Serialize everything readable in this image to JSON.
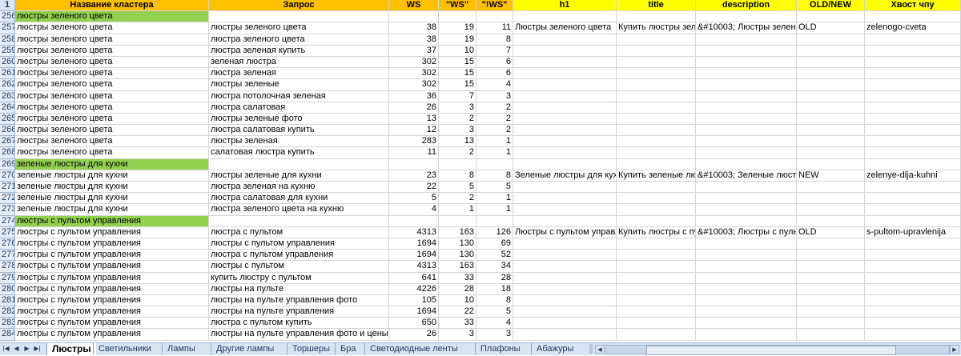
{
  "header": {
    "rownum": "1",
    "cols": [
      "Название кластера",
      "Запрос",
      "WS",
      "\"WS\"",
      "\"!WS\"",
      "h1",
      "title",
      "description",
      "OLD/NEW",
      "Хвост чпу"
    ]
  },
  "rows": [
    {
      "n": "256",
      "group": true,
      "name": "люстры зеленого цвета"
    },
    {
      "n": "257",
      "name": "люстры зеленого цвета",
      "q": "люстры зеленого цвета",
      "ws": "38",
      "ws2": "19",
      "ws3": "11",
      "h1": "Люстры зеленого цвета",
      "title": "Купить люстры зеле",
      "desc": "&#10003; Люстры зеленого",
      "old": "OLD",
      "tail": "zelenogo-cveta"
    },
    {
      "n": "258",
      "name": "люстры зеленого цвета",
      "q": "люстра зеленого цвета",
      "ws": "38",
      "ws2": "19",
      "ws3": "8"
    },
    {
      "n": "259",
      "name": "люстры зеленого цвета",
      "q": "люстра зеленая купить",
      "ws": "37",
      "ws2": "10",
      "ws3": "7"
    },
    {
      "n": "260",
      "name": "люстры зеленого цвета",
      "q": "зеленая люстра",
      "ws": "302",
      "ws2": "15",
      "ws3": "6"
    },
    {
      "n": "261",
      "name": "люстры зеленого цвета",
      "q": "люстра зеленая",
      "ws": "302",
      "ws2": "15",
      "ws3": "6"
    },
    {
      "n": "262",
      "name": "люстры зеленого цвета",
      "q": "люстры зеленые",
      "ws": "302",
      "ws2": "15",
      "ws3": "4"
    },
    {
      "n": "263",
      "name": "люстры зеленого цвета",
      "q": "люстра потолочная зеленая",
      "ws": "36",
      "ws2": "7",
      "ws3": "3"
    },
    {
      "n": "264",
      "name": "люстры зеленого цвета",
      "q": "люстра салатовая",
      "ws": "26",
      "ws2": "3",
      "ws3": "2"
    },
    {
      "n": "265",
      "name": "люстры зеленого цвета",
      "q": "люстры зеленые фото",
      "ws": "13",
      "ws2": "2",
      "ws3": "2"
    },
    {
      "n": "266",
      "name": "люстры зеленого цвета",
      "q": "люстра салатовая купить",
      "ws": "12",
      "ws2": "3",
      "ws3": "2"
    },
    {
      "n": "267",
      "name": "люстры зеленого цвета",
      "q": "люстры зеленая",
      "ws": "283",
      "ws2": "13",
      "ws3": "1"
    },
    {
      "n": "268",
      "name": "люстры зеленого цвета",
      "q": "салатовая люстра купить",
      "ws": "11",
      "ws2": "2",
      "ws3": "1"
    },
    {
      "n": "269",
      "group": true,
      "name": "зеленые люстры для кухни"
    },
    {
      "n": "270",
      "name": "зеленые люстры для кухни",
      "q": "люстры зеленые для кухни",
      "ws": "23",
      "ws2": "8",
      "ws3": "8",
      "h1": "Зеленые люстры для кухни",
      "title": "Купить зеленые люс",
      "desc": "&#10003; Зеленые люстры",
      "old": "NEW",
      "tail": "zelenye-dlja-kuhni"
    },
    {
      "n": "271",
      "name": "зеленые люстры для кухни",
      "q": "люстра зеленая на кухню",
      "ws": "22",
      "ws2": "5",
      "ws3": "5"
    },
    {
      "n": "272",
      "name": "зеленые люстры для кухни",
      "q": "люстра салатовая для кухни",
      "ws": "5",
      "ws2": "2",
      "ws3": "1"
    },
    {
      "n": "273",
      "name": "зеленые люстры для кухни",
      "q": "люстра зеленого цвета на кухню",
      "ws": "4",
      "ws2": "1",
      "ws3": "1"
    },
    {
      "n": "274",
      "group": true,
      "name": "люстры с пультом управления"
    },
    {
      "n": "275",
      "name": "люстры с пультом управления",
      "q": "люстра с пультом",
      "ws": "4313",
      "ws2": "163",
      "ws3": "126",
      "h1": "Люстры с пультом управлен",
      "title": "Купить люстры с пул",
      "desc": "&#10003; Люстры с пультом",
      "old": "OLD",
      "tail": "s-pultom-upravlenija"
    },
    {
      "n": "276",
      "name": "люстры с пультом управления",
      "q": "люстры с пультом управления",
      "ws": "1694",
      "ws2": "130",
      "ws3": "69"
    },
    {
      "n": "277",
      "name": "люстры с пультом управления",
      "q": "люстра с пультом управления",
      "ws": "1694",
      "ws2": "130",
      "ws3": "52"
    },
    {
      "n": "278",
      "name": "люстры с пультом управления",
      "q": "люстры с пультом",
      "ws": "4313",
      "ws2": "163",
      "ws3": "34"
    },
    {
      "n": "279",
      "name": "люстры с пультом управления",
      "q": "купить люстру с пультом",
      "ws": "641",
      "ws2": "33",
      "ws3": "28"
    },
    {
      "n": "280",
      "name": "люстры с пультом управления",
      "q": "люстры на пульте",
      "ws": "4226",
      "ws2": "28",
      "ws3": "18"
    },
    {
      "n": "281",
      "name": "люстры с пультом управления",
      "q": "люстры на пульте управления фото",
      "ws": "105",
      "ws2": "10",
      "ws3": "8"
    },
    {
      "n": "282",
      "name": "люстры с пультом управления",
      "q": "люстры на пульте управления",
      "ws": "1694",
      "ws2": "22",
      "ws3": "5"
    },
    {
      "n": "283",
      "name": "люстры с пультом управления",
      "q": "люстра с пультом купить",
      "ws": "650",
      "ws2": "33",
      "ws3": "4"
    },
    {
      "n": "284",
      "name": "люстры с пультом управления",
      "q": "люстры на пульте управления фото и цены",
      "ws": "26",
      "ws2": "3",
      "ws3": "3"
    }
  ],
  "tabs": [
    "Люстры",
    "Светильники",
    "Лампы",
    "Другие лампы",
    "Торшеры",
    "Бра",
    "Светодиодные ленты",
    "Плафоны",
    "Абажуры"
  ],
  "active_tab": "Люстры",
  "nav_icons": [
    "first-sheet-icon",
    "prev-sheet-icon",
    "next-sheet-icon",
    "last-sheet-icon"
  ],
  "colors": {
    "header_orange": "#ffc000",
    "header_yellow": "#ffff00",
    "group_green": "#92d050"
  }
}
